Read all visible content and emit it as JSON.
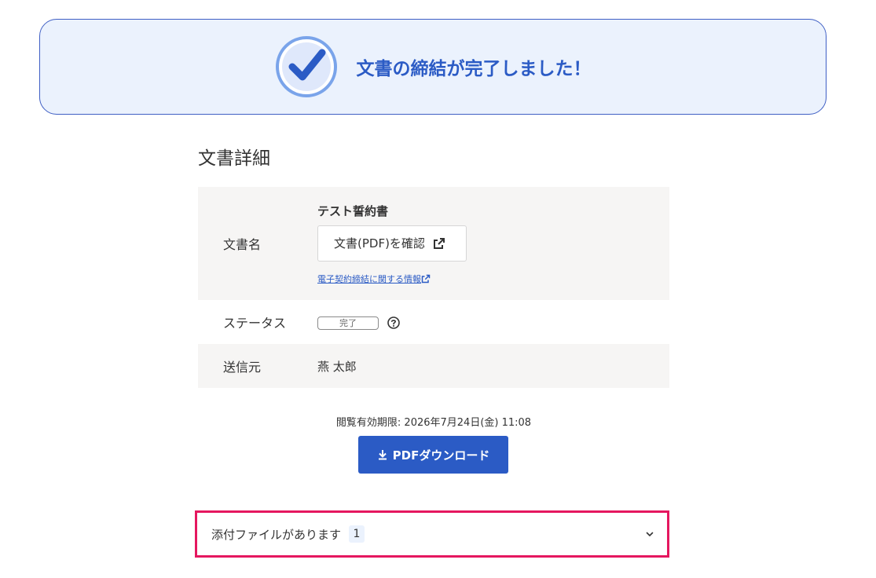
{
  "banner": {
    "message": "文書の締結が完了しました！"
  },
  "section": {
    "title": "文書詳細"
  },
  "details": {
    "name_label": "文書名",
    "doc_title": "テスト誓約書",
    "confirm_button": "文書(PDF)を確認",
    "info_link": "電子契約締結に関する情報",
    "status_label": "ステータス",
    "status_value": "完了",
    "sender_label": "送信元",
    "sender_value": "燕 太郎"
  },
  "footer": {
    "deadline": "閲覧有効期限: 2026年7月24日(金) 11:08",
    "download_button": "PDFダウンロード"
  },
  "attachments": {
    "label": "添付ファイルがあります",
    "count": "1"
  },
  "colors": {
    "accent": "#2b5bc5",
    "banner_bg": "#ebf2fd",
    "highlight": "#e5175f",
    "row_bg": "#f6f5f4"
  },
  "icons": [
    "check-circle-icon",
    "external-link-icon",
    "help-circle-icon",
    "download-icon",
    "chevron-down-icon"
  ]
}
